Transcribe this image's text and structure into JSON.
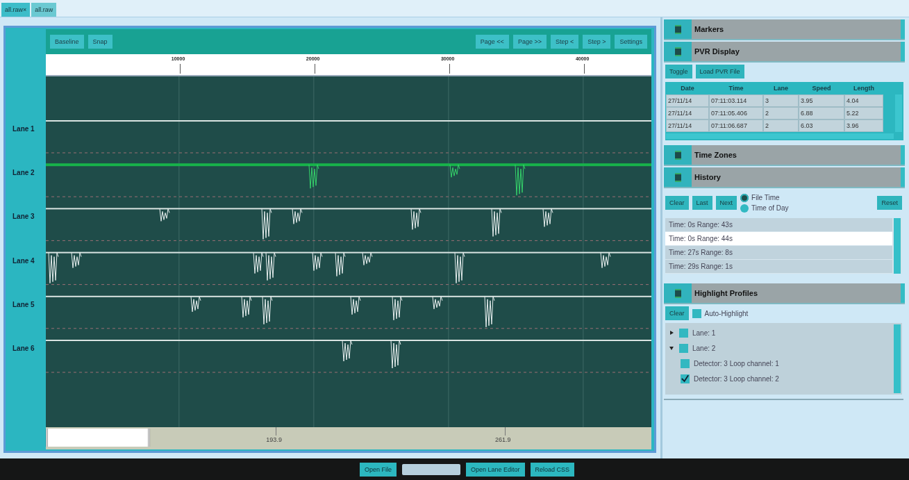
{
  "tabs": [
    {
      "label": "all.raw",
      "close": "×",
      "selected": true
    },
    {
      "label": "all.raw",
      "selected": false
    }
  ],
  "toolbar": {
    "left_buttons": [
      "Baseline",
      "Snap"
    ],
    "right_buttons": [
      "Page <<",
      "Page >>",
      "Step <",
      "Step >",
      "Settings"
    ]
  },
  "ruler": {
    "ticks": [
      "10000",
      "20000",
      "30000",
      "40000"
    ]
  },
  "lanes": [
    {
      "label": "Lane 1",
      "highlighted": false
    },
    {
      "label": "Lane 2",
      "highlighted": true
    },
    {
      "label": "Lane 3",
      "highlighted": false
    },
    {
      "label": "Lane 4",
      "highlighted": false
    },
    {
      "label": "Lane 5",
      "highlighted": false
    },
    {
      "label": "Lane 6",
      "highlighted": false
    }
  ],
  "overview": {
    "ticks": [
      "193.9",
      "261.9"
    ]
  },
  "markers": {
    "title": "Markers"
  },
  "pvr_display": {
    "title": "PVR Display",
    "buttons": [
      "Toggle",
      "Load PVR File"
    ],
    "columns": [
      "Date",
      "Time",
      "Lane",
      "Speed",
      "Length"
    ],
    "rows": [
      [
        "27/11/14",
        "07:11:03.114",
        "3",
        "3.95",
        "4.04"
      ],
      [
        "27/11/14",
        "07:11:05.406",
        "2",
        "6.88",
        "5.22"
      ],
      [
        "27/11/14",
        "07:11:06.687",
        "2",
        "6.03",
        "3.96"
      ]
    ]
  },
  "time_zones": {
    "title": "Time Zones"
  },
  "history": {
    "title": "History",
    "buttons": [
      "Clear",
      "Last",
      "Next"
    ],
    "radios": [
      {
        "label": "File Time",
        "selected": true
      },
      {
        "label": "Time of Day",
        "selected": false
      }
    ],
    "reset": "Reset",
    "entries": [
      {
        "text": "Time: 0s Range: 43s",
        "selected": false
      },
      {
        "text": "Time: 0s Range: 44s",
        "selected": true
      },
      {
        "text": "Time: 27s Range: 8s",
        "selected": false
      },
      {
        "text": "Time: 29s Range: 1s",
        "selected": false
      }
    ]
  },
  "highlight_profiles": {
    "title": "Highlight Profiles",
    "clear": "Clear",
    "auto_highlight": {
      "label": "Auto-Highlight",
      "checked": false
    },
    "tree": [
      {
        "label": "Lane: 1",
        "expanded": false,
        "checked": false
      },
      {
        "label": "Lane: 2",
        "expanded": true,
        "checked": false,
        "children": [
          {
            "label": "Detector: 3 Loop channel: 1",
            "checked": false
          },
          {
            "label": "Detector: 3 Loop channel: 2",
            "checked": true
          }
        ]
      }
    ]
  },
  "bottom_bar": {
    "buttons": [
      "Open File",
      "Open Lane Editor",
      "Reload CSS"
    ]
  }
}
